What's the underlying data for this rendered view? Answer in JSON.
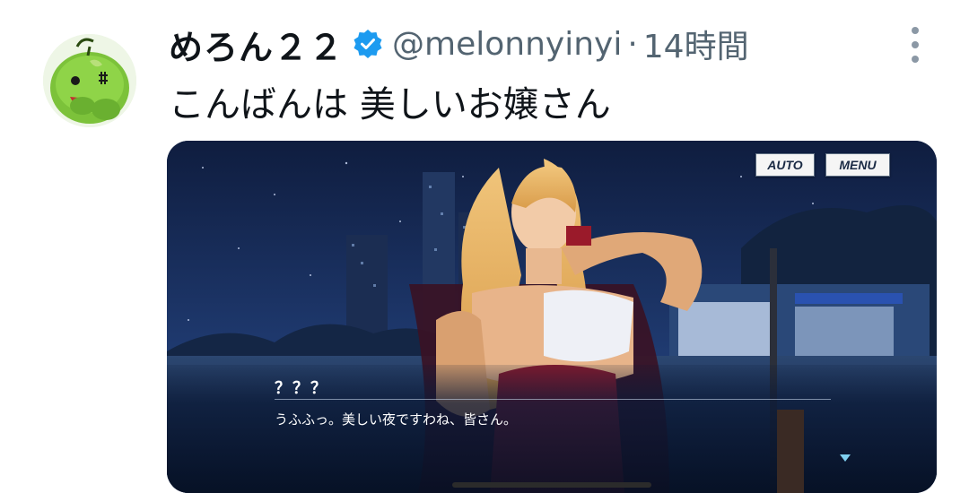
{
  "tweet": {
    "display_name": "めろん２２",
    "verified_icon": "verified-badge-icon",
    "handle": "@melonnyinyi",
    "separator": "·",
    "time": "14時間",
    "text": "こんばんは 美しいお嬢さん",
    "more_icon": "more-vertical-icon"
  },
  "media": {
    "buttons": {
      "auto": "AUTO",
      "menu": "MENU"
    },
    "speaker": "？？？",
    "dialogue": "うふふっ。美しい夜ですわね、皆さん。",
    "next_icon": "next-arrow-icon"
  },
  "colors": {
    "verified": "#1d9bf0",
    "handle": "#536471",
    "text": "#0f1419"
  }
}
